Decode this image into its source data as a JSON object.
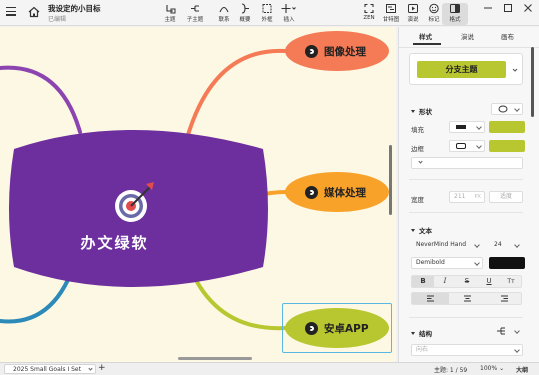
{
  "app": {
    "title": "我设定的小目标",
    "status": "已编辑"
  },
  "toolbar": {
    "topic": "主题",
    "subtopic": "子主题",
    "relation": "联系",
    "summary": "概要",
    "boundary": "外框",
    "insert": "插入",
    "zen": "ZEN",
    "outline_view": "甘特图",
    "present": "演说",
    "marker": "标记",
    "format": "格式"
  },
  "mindmap": {
    "central_topic": "办文绿软",
    "topics": [
      {
        "label": "图像处理",
        "color": "#f47b55"
      },
      {
        "label": "媒体处理",
        "color": "#f9a22a"
      },
      {
        "label": "安卓APP",
        "color": "#b8c630"
      }
    ],
    "central_color": "#6d2e9e",
    "canvas_bg": "#fdf8e4"
  },
  "panel": {
    "tabs": [
      "样式",
      "演说",
      "画布"
    ],
    "active_tab": "样式",
    "style_button": "分支主题",
    "shape_section": "形状",
    "fill_label": "填充",
    "border_label": "边框",
    "fill_color": "#b8c630",
    "border_color": "#b8c630",
    "width_label": "宽度",
    "width_value": "211",
    "width_unit": "PX",
    "width_reset": "适度",
    "text_section": "文本",
    "font_family": "NeverMind Hand",
    "font_size": "24",
    "font_weight": "Demibold",
    "text_color": "#111111",
    "format_bold": "B",
    "format_italic": "I",
    "format_strike": "S",
    "format_underline": "U",
    "format_case": "Tт",
    "structure_section": "结构",
    "structure_value": "向右"
  },
  "statusbar": {
    "sheet_name": "2025 Small Goals I Set",
    "add_sheet": "+",
    "topic_count": "主题: 1 / 59",
    "zoom": "100%",
    "view_mode": "大纲"
  }
}
